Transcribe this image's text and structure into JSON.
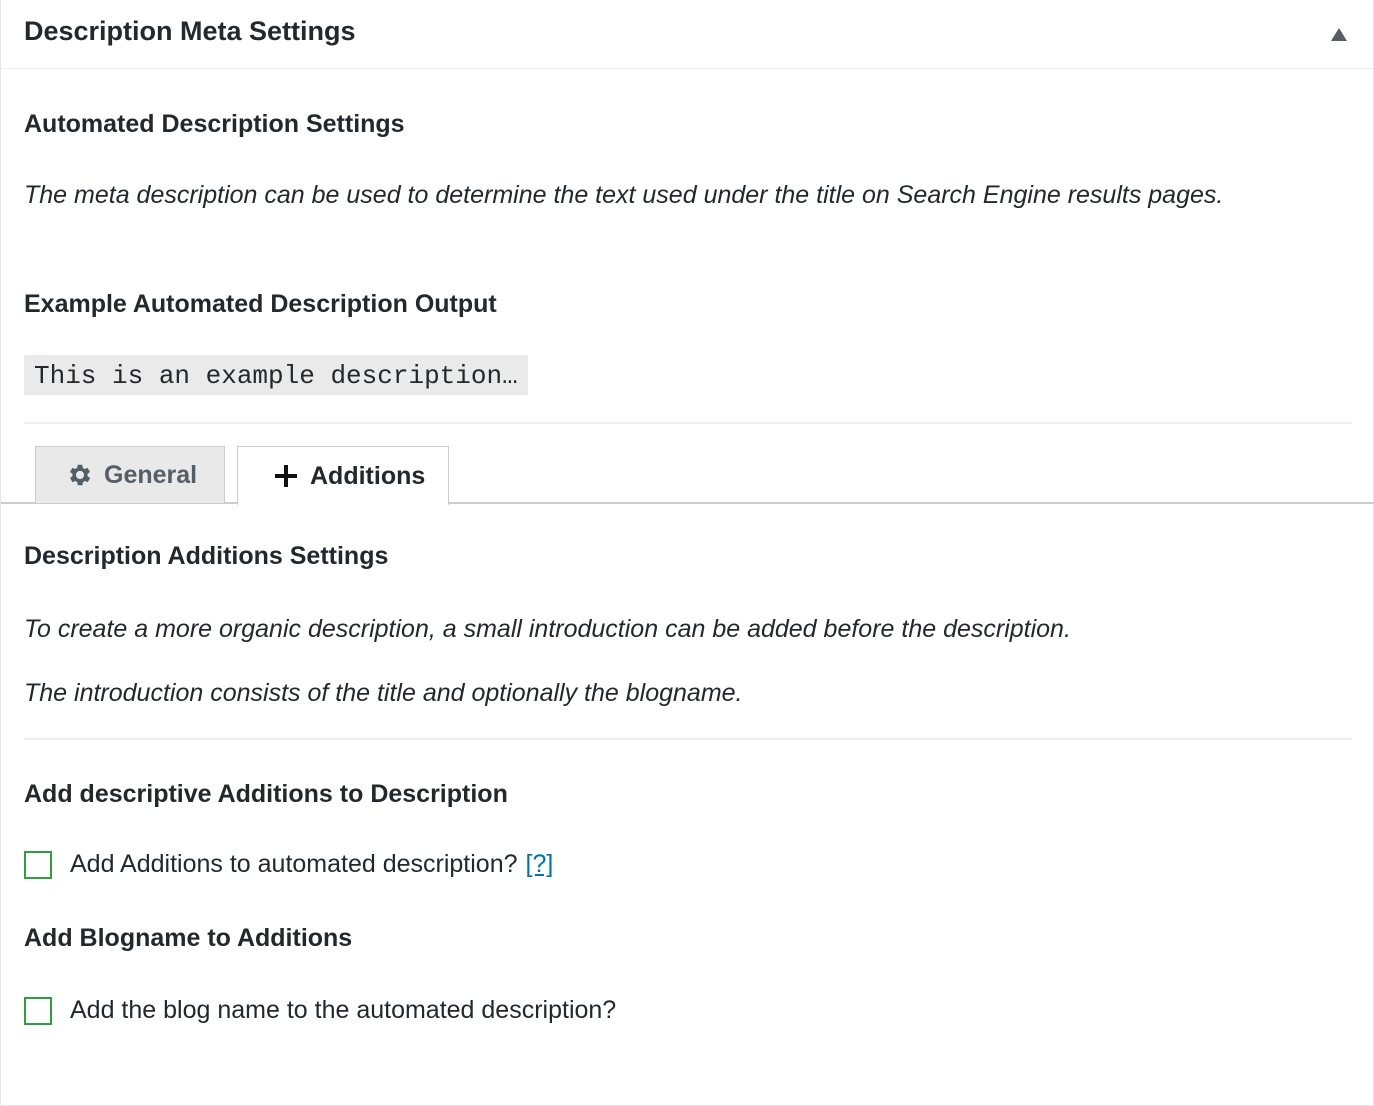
{
  "panel": {
    "title": "Description Meta Settings",
    "toggle_icon": "triangle-up-icon"
  },
  "automated": {
    "heading": "Automated Description Settings",
    "description": "The meta description can be used to determine the text used under the title on Search Engine results pages.",
    "example_heading": "Example Automated Description Output",
    "example_text": "This is an example description…"
  },
  "tabs": [
    {
      "label": "General",
      "icon": "gear-icon",
      "active": false
    },
    {
      "label": "Additions",
      "icon": "plus-icon",
      "active": true
    }
  ],
  "additions": {
    "heading": "Description Additions Settings",
    "desc1": "To create a more organic description, a small introduction can be added before the description.",
    "desc2": "The introduction consists of the title and optionally the blogname.",
    "add_heading": "Add descriptive Additions to Description",
    "add_checkbox_label": "Add Additions to automated description?",
    "add_checkbox_checked": false,
    "help_link": "[?]",
    "blogname_heading": "Add Blogname to Additions",
    "blogname_checkbox_label": "Add the blog name to the automated description?",
    "blogname_checkbox_checked": false
  },
  "colors": {
    "text": "#23282d",
    "link": "#0073aa",
    "checkbox_border": "#2e9f3c",
    "code_bg": "#eaeaea"
  }
}
